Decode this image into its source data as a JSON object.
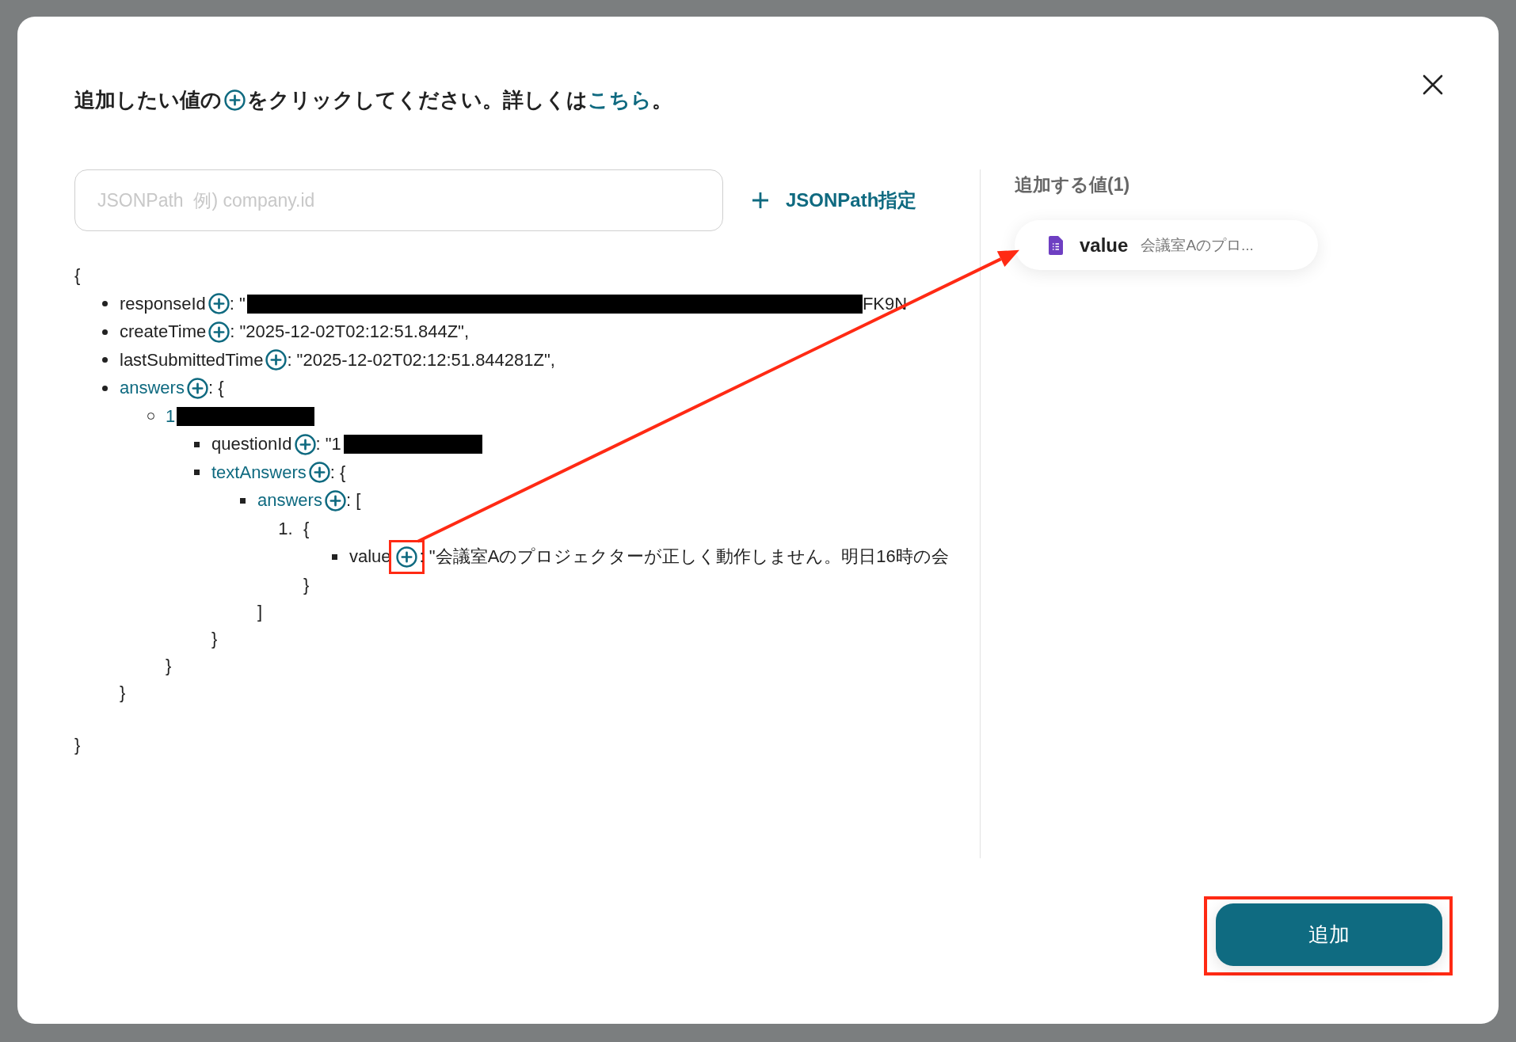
{
  "dialog": {
    "title": {
      "before": "追加したい値の",
      "after": "をクリックしてください。詳しくは",
      "link": "こちら",
      "end": "。"
    },
    "search": {
      "placeholder": "JSONPath  例) company.id"
    },
    "jsonpath_button": {
      "label": "JSONPath指定"
    },
    "tree": {
      "open": "{",
      "close": "}",
      "children": [
        {
          "kind": "disc",
          "key": "responseId",
          "container": false,
          "value": ": \"",
          "redacted": true,
          "value_after": "FK9N"
        },
        {
          "kind": "disc",
          "key": "createTime",
          "container": false,
          "value": ": \"2025-12-02T02:12:51.844Z\","
        },
        {
          "kind": "disc",
          "key": "lastSubmittedTime",
          "container": false,
          "value": ": \"2025-12-02T02:12:51.844281Z\","
        },
        {
          "kind": "disc",
          "key": "answers",
          "container": true,
          "value": ": {",
          "close": "}",
          "children": [
            {
              "kind": "circle",
              "key": "1",
              "container": true,
              "key_redacted": true,
              "close": "}",
              "children": [
                {
                  "kind": "square",
                  "key": "questionId",
                  "container": false,
                  "value": ": \"1",
                  "redacted": true
                },
                {
                  "kind": "square",
                  "key": "textAnswers",
                  "container": true,
                  "value": ": {",
                  "close": "}",
                  "children": [
                    {
                      "kind": "square",
                      "key": "answers",
                      "container": true,
                      "value": ": [",
                      "close": "]",
                      "children": [
                        {
                          "kind": "number",
                          "index": "1.",
                          "value": "{",
                          "close": "}",
                          "children": [
                            {
                              "kind": "square",
                              "key": "value",
                              "container": false,
                              "highlighted": true,
                              "value": ": \"会議室Aのプロジェクターが正しく動作しません。明日16時の会"
                            }
                          ]
                        }
                      ]
                    }
                  ]
                }
              ]
            }
          ]
        }
      ]
    },
    "selected_panel": {
      "title": "追加する値(1)",
      "items": [
        {
          "key": "value",
          "preview": "会議室Aのプロ..."
        }
      ]
    },
    "add_button": {
      "label": "追加",
      "highlighted": true
    },
    "annotation_arrow": true
  }
}
